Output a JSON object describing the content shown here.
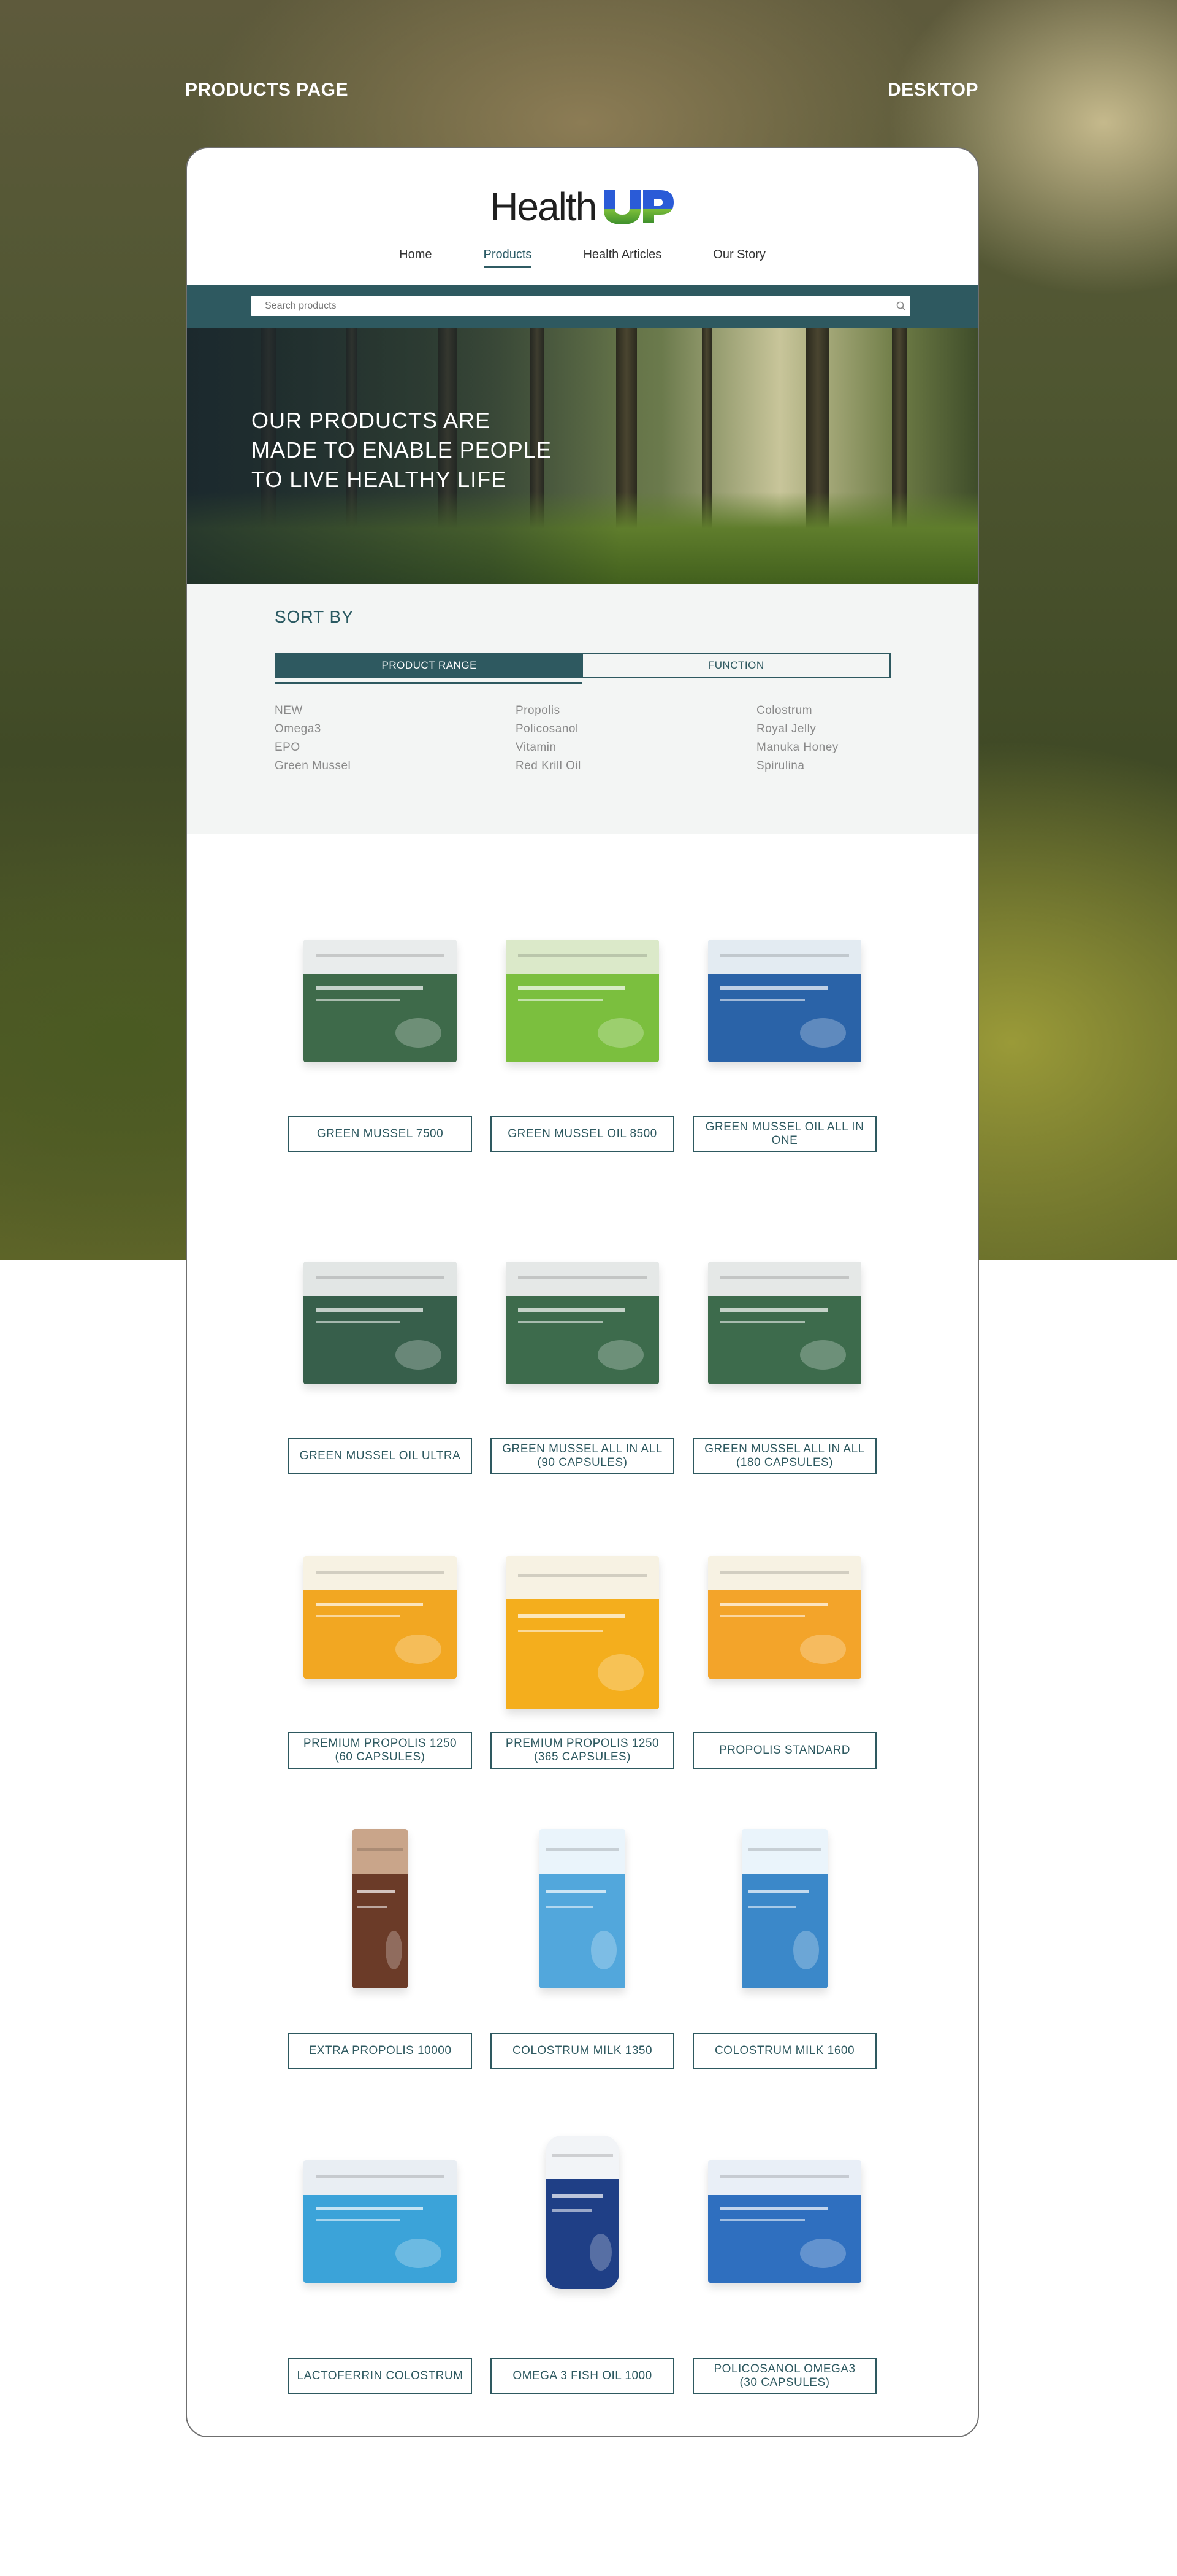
{
  "labels": {
    "left": "PRODUCTS PAGE",
    "right": "DESKTOP"
  },
  "brand": {
    "name": "Health",
    "suffix": "UP",
    "accent": "#2a5bd7",
    "accent2": "#7dbf3a"
  },
  "nav": {
    "items": [
      {
        "label": "Home"
      },
      {
        "label": "Products"
      },
      {
        "label": "Health Articles"
      },
      {
        "label": "Our Story"
      }
    ],
    "active": "Products"
  },
  "search": {
    "placeholder": "Search products"
  },
  "hero": {
    "title": "OUR PRODUCTS ARE\nMADE TO ENABLE PEOPLE\nTO LIVE HEALTHY LIFE"
  },
  "sort": {
    "title": "SORT BY",
    "tabs": [
      {
        "label": "PRODUCT RANGE"
      },
      {
        "label": "FUNCTION"
      }
    ],
    "filters": [
      "NEW",
      "Propolis",
      "Colostrum",
      "Omega3",
      "Policosanol",
      "Royal Jelly",
      "EPO",
      "Vitamin",
      "Manuka Honey",
      "Green Mussel",
      "Red Krill Oil",
      "Spirulina"
    ]
  },
  "products": [
    {
      "name": "GREEN MUSSEL 7500",
      "box_color": "#3e6a4a",
      "accent": "#e9ecec"
    },
    {
      "name": "GREEN MUSSEL OIL 8500",
      "box_color": "#7bbf3e",
      "accent": "#dbe9c9"
    },
    {
      "name": "GREEN MUSSEL OIL ALL IN ONE",
      "box_color": "#2a63a8",
      "accent": "#e3ebf2"
    },
    {
      "name": "GREEN MUSSEL OIL ULTRA",
      "box_color": "#375f4b",
      "accent": "#e2e6e5"
    },
    {
      "name": "GREEN MUSSEL ALL IN ALL\n(90 CAPSULES)",
      "box_color": "#3d6b4c",
      "accent": "#e5e8e7"
    },
    {
      "name": "GREEN MUSSEL ALL IN ALL\n(180 CAPSULES)",
      "box_color": "#3d6b4c",
      "accent": "#e5e8e7"
    },
    {
      "name": "PREMIUM PROPOLIS 1250\n(60 CAPSULES)",
      "box_color": "#f2a722",
      "accent": "#f7f2e3"
    },
    {
      "name": "PREMIUM PROPOLIS 1250\n(365 CAPSULES)",
      "box_color": "#f4ae1d",
      "accent": "#f7f2e3"
    },
    {
      "name": "PROPOLIS STANDARD",
      "box_color": "#f3a42a",
      "accent": "#f7f2e3"
    },
    {
      "name": "EXTRA PROPOLIS 10000",
      "box_color": "#6b3b28",
      "accent": "#c9a58a"
    },
    {
      "name": "COLOSTRUM MILK 1350",
      "box_color": "#52a7dc",
      "accent": "#eaf4fb"
    },
    {
      "name": "COLOSTRUM MILK 1600",
      "box_color": "#3b88c9",
      "accent": "#eaf4fb"
    },
    {
      "name": "LACTOFERRIN COLOSTRUM",
      "box_color": "#3ba3d9",
      "accent": "#e9eef3"
    },
    {
      "name": "OMEGA 3 FISH OIL 1000",
      "box_color": "#1f3f86",
      "accent": "#f2f4f7"
    },
    {
      "name": "POLICOSANOL OMEGA3\n(30 CAPSULES)",
      "box_color": "#2f6fbf",
      "accent": "#e9eff7"
    }
  ]
}
